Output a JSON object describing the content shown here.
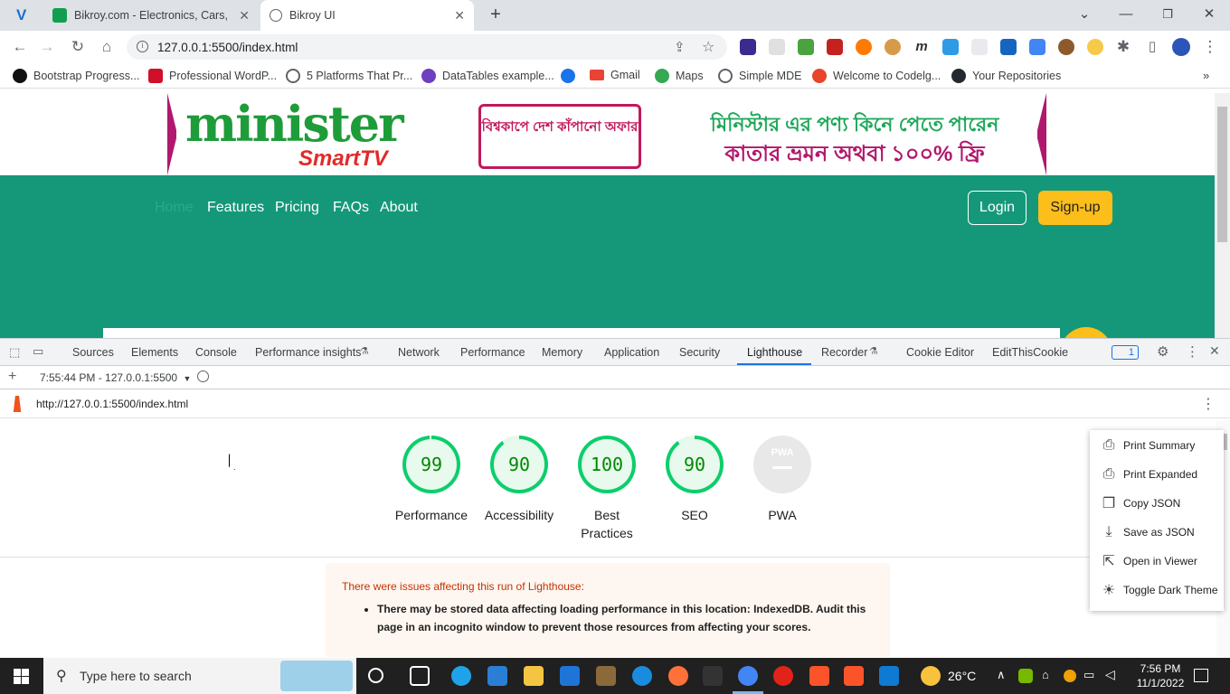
{
  "browser": {
    "tabs": [
      {
        "title": "",
        "favicon_color": "#1a6fd1"
      },
      {
        "title": "Bikroy.com - Electronics, Cars, Pro",
        "favicon_color": "#119f4f"
      },
      {
        "title": "Bikroy UI",
        "favicon_color": "#5f6368"
      }
    ],
    "new_tab_symbol": "+",
    "url": "127.0.0.1:5500/index.html",
    "bookmarks": [
      {
        "label": "Bootstrap Progress...",
        "icon_color": "#111111"
      },
      {
        "label": "Professional WordP...",
        "icon_color": "#d0102b"
      },
      {
        "label": "5 Platforms That Pr...",
        "icon_color": "#5f6368"
      },
      {
        "label": "DataTables example...",
        "icon_color": "#6e3fbf"
      },
      {
        "label": "",
        "icon_color": "#1a73e8"
      },
      {
        "label": "Gmail",
        "icon_color": "#ea4335"
      },
      {
        "label": "Maps",
        "icon_color": "#34a853"
      },
      {
        "label": "Simple MDE",
        "icon_color": "#5f6368"
      },
      {
        "label": "Welcome to Codelg...",
        "icon_color": "#e8452c"
      },
      {
        "label": "Your Repositories",
        "icon_color": "#24292f"
      }
    ]
  },
  "page": {
    "banner": {
      "brand_line1": "minister",
      "brand_line2": "SmartTV",
      "promo_badge": "বিশ্বকাপে দেশ কাঁপানো অফার",
      "promo_line1": "মিনিস্টার এর পণ্য কিনে পেতে পারেন",
      "promo_line2": "কাতার ভ্রমন অথবা ১০০% ফ্রি"
    },
    "nav": {
      "links": [
        "Home",
        "Features",
        "Pricing",
        "FAQs",
        "About"
      ],
      "login": "Login",
      "signup": "Sign-up"
    }
  },
  "devtools": {
    "tabs": [
      "Sources",
      "Elements",
      "Console",
      "Performance insights",
      "Network",
      "Performance",
      "Memory",
      "Application",
      "Security",
      "Lighthouse",
      "Recorder",
      "Cookie Editor",
      "EditThisCookie"
    ],
    "active_tab": "Lighthouse",
    "issues_count": "1",
    "report_selector": "7:55:44 PM - 127.0.0.1:5500",
    "report_url": "http://127.0.0.1:5500/index.html",
    "scores": [
      {
        "label": "Performance",
        "value": "99",
        "fraction": 0.99
      },
      {
        "label": "Accessibility",
        "value": "90",
        "fraction": 0.9
      },
      {
        "label": "Best Practices",
        "value": "100",
        "fraction": 1.0
      },
      {
        "label": "SEO",
        "value": "90",
        "fraction": 0.9
      },
      {
        "label": "PWA",
        "value": "",
        "fraction": 0
      }
    ],
    "pwa_badge": "PWA",
    "score_color": "#0cce6b",
    "warning": {
      "title": "There were issues affecting this run of Lighthouse:",
      "item": "There may be stored data affecting loading performance in this location: IndexedDB. Audit this page in an incognito window to prevent those resources from affecting your scores."
    },
    "menu": [
      "Print Summary",
      "Print Expanded",
      "Copy JSON",
      "Save as JSON",
      "Open in Viewer",
      "Toggle Dark Theme"
    ]
  },
  "taskbar": {
    "search_placeholder": "Type here to search",
    "weather": "26°C",
    "time": "7:56 PM",
    "date": "11/1/2022"
  }
}
